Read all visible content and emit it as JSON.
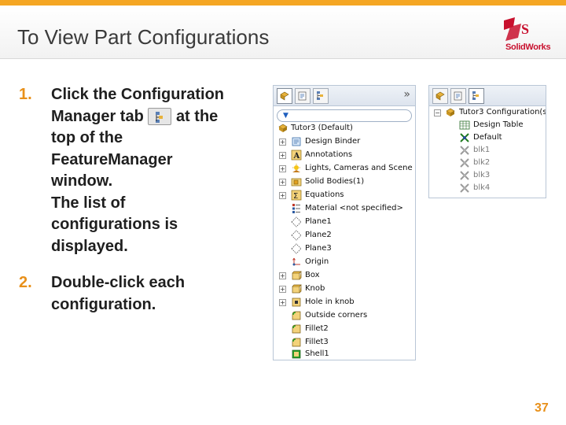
{
  "slide": {
    "title": "To View Part Configurations",
    "page_number": "37"
  },
  "logo": {
    "brand": "SolidWorks"
  },
  "steps": [
    {
      "num": "1.",
      "lines": [
        "Click the Configuration",
        "Manager tab",
        "at the",
        "top of the",
        "FeatureManager",
        "window.",
        "The list of",
        "configurations is",
        "displayed."
      ]
    },
    {
      "num": "2.",
      "lines": [
        "Double-click each",
        "configuration."
      ]
    }
  ],
  "feature_manager": {
    "collapse_glyph": "»",
    "tree": [
      {
        "label": "Tutor3 (Default)",
        "icon": "part-icon",
        "expand": false,
        "root": true
      },
      {
        "label": "Design Binder",
        "icon": "binder-icon",
        "expand": true
      },
      {
        "label": "Annotations",
        "icon": "annotations-icon",
        "expand": true
      },
      {
        "label": "Lights, Cameras and Scene",
        "icon": "lights-icon",
        "expand": true
      },
      {
        "label": "Solid Bodies(1)",
        "icon": "solid-bodies-icon",
        "expand": true
      },
      {
        "label": "Equations",
        "icon": "equations-icon",
        "expand": true
      },
      {
        "label": "Material <not specified>",
        "icon": "material-icon",
        "expand": false
      },
      {
        "label": "Plane1",
        "icon": "plane-icon",
        "expand": false
      },
      {
        "label": "Plane2",
        "icon": "plane-icon",
        "expand": false
      },
      {
        "label": "Plane3",
        "icon": "plane-icon",
        "expand": false
      },
      {
        "label": "Origin",
        "icon": "origin-icon",
        "expand": false
      },
      {
        "label": "Box",
        "icon": "feature-icon",
        "expand": true
      },
      {
        "label": "Knob",
        "icon": "feature-icon",
        "expand": true
      },
      {
        "label": "Hole in knob",
        "icon": "hole-icon",
        "expand": true
      },
      {
        "label": "Outside corners",
        "icon": "fillet-icon",
        "expand": false
      },
      {
        "label": "Fillet2",
        "icon": "fillet-icon",
        "expand": false
      },
      {
        "label": "Fillet3",
        "icon": "fillet-icon",
        "expand": false
      },
      {
        "label": "Shell1",
        "icon": "shell-icon",
        "expand": false
      }
    ]
  },
  "configuration_manager": {
    "root": "Tutor3 Configuration(s)",
    "items": [
      {
        "label": "Design Table",
        "icon": "design-table-icon",
        "active": true
      },
      {
        "label": "Default",
        "icon": "config-active-icon",
        "active": true
      },
      {
        "label": "blk1",
        "icon": "config-icon",
        "active": false
      },
      {
        "label": "blk2",
        "icon": "config-icon",
        "active": false
      },
      {
        "label": "blk3",
        "icon": "config-icon",
        "active": false
      },
      {
        "label": "blk4",
        "icon": "config-icon",
        "active": false
      }
    ]
  },
  "colors": {
    "accent": "#e8901a",
    "topbar": "#f5a623",
    "brand_red": "#c8102e"
  }
}
